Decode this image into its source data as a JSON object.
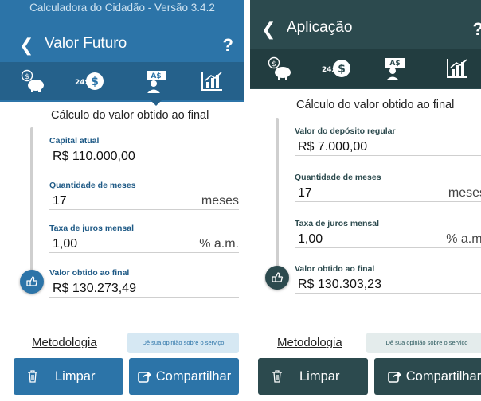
{
  "colors": {
    "left_primary": "#2c74a8",
    "left_tabbar": "#25618b",
    "right_primary": "#2c4a4e",
    "right_tabbar": "#223d40"
  },
  "left": {
    "window_title": "Calculadora do Cidadão - Versão 3.4.2",
    "back_icon": "chevron-left-icon",
    "screen_title": "Valor Futuro",
    "help_label": "?",
    "tabs": [
      {
        "icon": "piggy-bank-icon",
        "selected": false
      },
      {
        "icon": "24x-installments-icon",
        "selected": false
      },
      {
        "icon": "person-money-icon",
        "selected": true
      },
      {
        "icon": "bar-chart-icon",
        "selected": false
      }
    ],
    "content_title": "Cálculo do valor obtido ao final",
    "fields": [
      {
        "label": "Capital atual",
        "value": "R$ 110.000,00",
        "unit": ""
      },
      {
        "label": "Quantidade de meses",
        "value": "17",
        "unit": "meses"
      },
      {
        "label": "Taxa de juros mensal",
        "value": "1,00",
        "unit": "% a.m."
      },
      {
        "label": "Valor obtido ao final",
        "value": "R$ 130.273,49",
        "unit": ""
      }
    ],
    "methodology_link": "Metodologia",
    "opinion_button": "Dê sua opinião sobre o serviço",
    "clear_button": "Limpar",
    "share_button": "Compartilhar"
  },
  "right": {
    "back_icon": "chevron-left-icon",
    "screen_title": "Aplicação",
    "help_label": "?",
    "tabs": [
      {
        "icon": "piggy-bank-icon",
        "selected": false
      },
      {
        "icon": "24x-installments-icon",
        "selected": false
      },
      {
        "icon": "person-money-icon",
        "selected": true
      },
      {
        "icon": "bar-chart-icon",
        "selected": false
      }
    ],
    "content_title": "Cálculo do valor obtido ao final",
    "fields": [
      {
        "label": "Valor do depósito regular",
        "value": "R$ 7.000,00",
        "unit": ""
      },
      {
        "label": "Quantidade de meses",
        "value": "17",
        "unit": "meses"
      },
      {
        "label": "Taxa de juros mensal",
        "value": "1,00",
        "unit": "% a.m."
      },
      {
        "label": "Valor obtido ao final",
        "value": "R$ 130.303,23",
        "unit": ""
      }
    ],
    "methodology_link": "Metodologia",
    "opinion_button": "Dê sua opinião sobre o serviço",
    "clear_button": "Limpar",
    "share_button": "Compartilhar"
  }
}
